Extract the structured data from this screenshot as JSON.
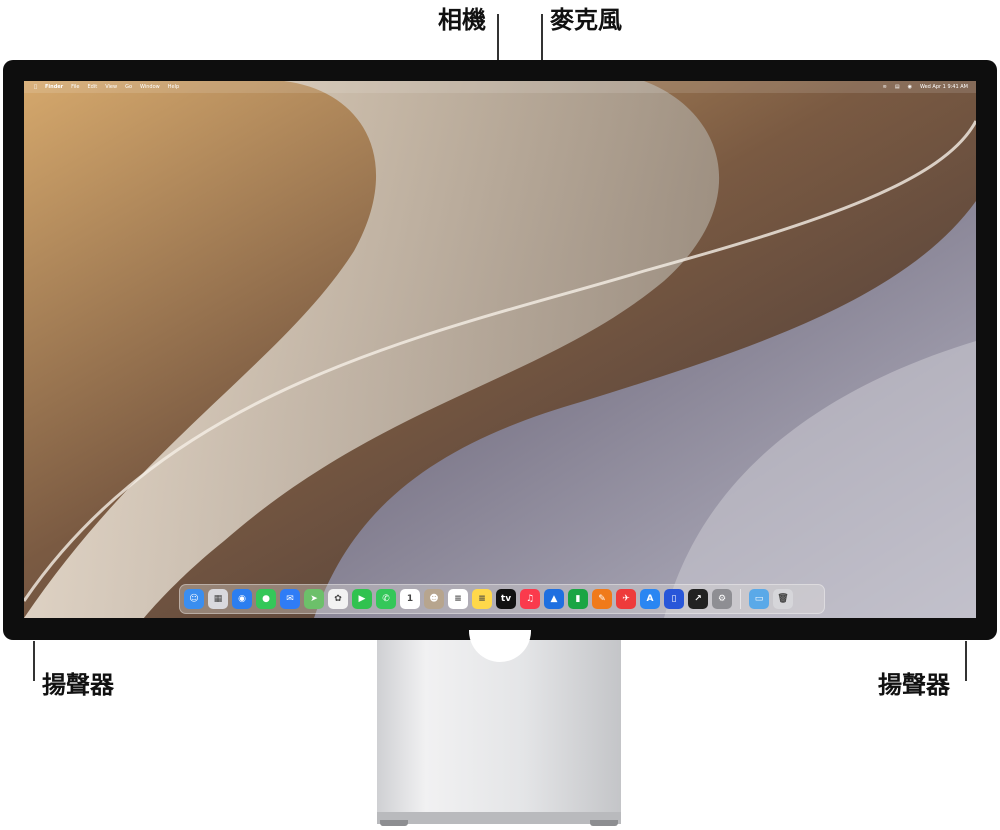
{
  "callouts": {
    "camera": "相機",
    "microphone": "麥克風",
    "speaker_left": "揚聲器",
    "speaker_right": "揚聲器"
  },
  "menubar": {
    "apple_icon": "apple-icon",
    "items": [
      "Finder",
      "File",
      "Edit",
      "View",
      "Go",
      "Window",
      "Help"
    ],
    "status": {
      "wifi_icon": "wifi-icon",
      "control_icon": "control-center-icon",
      "user_icon": "user-icon",
      "datetime": "Wed Apr 1  9:41 AM"
    }
  },
  "dock": {
    "apps": [
      {
        "name": "finder",
        "color": "#3a8ef0",
        "glyph": "☺"
      },
      {
        "name": "launchpad",
        "color": "#d9d9de",
        "glyph": "▦"
      },
      {
        "name": "safari",
        "color": "#2c7ef0",
        "glyph": "◉"
      },
      {
        "name": "messages",
        "color": "#34c759",
        "glyph": "●"
      },
      {
        "name": "mail",
        "color": "#2f7cf6",
        "glyph": "✉"
      },
      {
        "name": "maps",
        "color": "#6cc06a",
        "glyph": "➤"
      },
      {
        "name": "photos",
        "color": "#f2f2f2",
        "glyph": "✿"
      },
      {
        "name": "facetime",
        "color": "#30c24f",
        "glyph": "▶"
      },
      {
        "name": "phone",
        "color": "#34c759",
        "glyph": "✆"
      },
      {
        "name": "calendar",
        "color": "#ffffff",
        "glyph": "1"
      },
      {
        "name": "contacts",
        "color": "#b7a58e",
        "glyph": "☻"
      },
      {
        "name": "reminders",
        "color": "#ffffff",
        "glyph": "≡"
      },
      {
        "name": "notes",
        "color": "#ffd84a",
        "glyph": "≡"
      },
      {
        "name": "tv",
        "color": "#111111",
        "glyph": "tv"
      },
      {
        "name": "music",
        "color": "#fa3a4c",
        "glyph": "♫"
      },
      {
        "name": "keynote",
        "color": "#1f6fe0",
        "glyph": "▲"
      },
      {
        "name": "numbers",
        "color": "#1aa544",
        "glyph": "▮"
      },
      {
        "name": "pages",
        "color": "#f07a1a",
        "glyph": "✎"
      },
      {
        "name": "launch",
        "color": "#ee3b3b",
        "glyph": "✈"
      },
      {
        "name": "app-store",
        "color": "#2a86f2",
        "glyph": "A"
      },
      {
        "name": "simulator",
        "color": "#2856d9",
        "glyph": "▯"
      },
      {
        "name": "stocks",
        "color": "#222222",
        "glyph": "↗"
      },
      {
        "name": "system-settings",
        "color": "#8e8e93",
        "glyph": "⚙"
      }
    ],
    "trailing": [
      {
        "name": "downloads-folder",
        "color": "#5aa9e8",
        "glyph": "▭"
      },
      {
        "name": "trash",
        "color": "#d6d6da",
        "glyph": "🗑"
      }
    ]
  }
}
